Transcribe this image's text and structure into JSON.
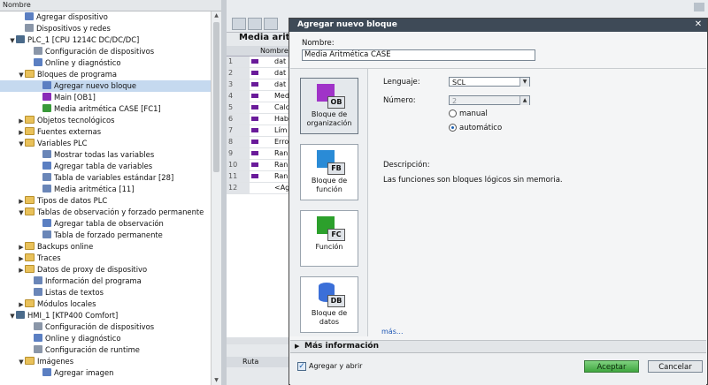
{
  "tree": {
    "header": "Nombre",
    "items": [
      {
        "label": "Agregar dispositivo",
        "indent": 2,
        "arrow": "",
        "icon": "add-device-icon",
        "cls": "i-blue"
      },
      {
        "label": "Dispositivos y redes",
        "indent": 2,
        "arrow": "",
        "icon": "network-icon",
        "cls": "i-gear"
      },
      {
        "label": "PLC_1 [CPU 1214C DC/DC/DC]",
        "indent": 1,
        "arrow": "▼",
        "icon": "plc-icon",
        "cls": "i-plc"
      },
      {
        "label": "Configuración de dispositivos",
        "indent": 3,
        "arrow": "",
        "icon": "device-config-icon",
        "cls": "i-gear"
      },
      {
        "label": "Online y diagnóstico",
        "indent": 3,
        "arrow": "",
        "icon": "diagnostic-icon",
        "cls": "i-blue"
      },
      {
        "label": "Bloques de programa",
        "indent": 2,
        "arrow": "▼",
        "icon": "folder-icon",
        "cls": "i-folder"
      },
      {
        "label": "Agregar nuevo bloque",
        "indent": 4,
        "arrow": "",
        "icon": "add-block-icon",
        "cls": "i-blue",
        "sel": true
      },
      {
        "label": "Main [OB1]",
        "indent": 4,
        "arrow": "",
        "icon": "ob-block-icon",
        "cls": "i-purple"
      },
      {
        "label": "Media aritmética CASE [FC1]",
        "indent": 4,
        "arrow": "",
        "icon": "fc-block-icon",
        "cls": "i-green"
      },
      {
        "label": "Objetos tecnológicos",
        "indent": 2,
        "arrow": "▶",
        "icon": "folder-icon",
        "cls": "i-folder"
      },
      {
        "label": "Fuentes externas",
        "indent": 2,
        "arrow": "▶",
        "icon": "folder-icon",
        "cls": "i-folder"
      },
      {
        "label": "Variables PLC",
        "indent": 2,
        "arrow": "▼",
        "icon": "folder-icon",
        "cls": "i-folder"
      },
      {
        "label": "Mostrar todas las variables",
        "indent": 4,
        "arrow": "",
        "icon": "variables-icon",
        "cls": "i-table"
      },
      {
        "label": "Agregar tabla de variables",
        "indent": 4,
        "arrow": "",
        "icon": "add-table-icon",
        "cls": "i-blue"
      },
      {
        "label": "Tabla de variables estándar [28]",
        "indent": 4,
        "arrow": "",
        "icon": "table-icon",
        "cls": "i-table"
      },
      {
        "label": "Media aritmética [11]",
        "indent": 4,
        "arrow": "",
        "icon": "table-icon",
        "cls": "i-table"
      },
      {
        "label": "Tipos de datos PLC",
        "indent": 2,
        "arrow": "▶",
        "icon": "folder-icon",
        "cls": "i-folder"
      },
      {
        "label": "Tablas de observación y forzado permanente",
        "indent": 2,
        "arrow": "▼",
        "icon": "folder-icon",
        "cls": "i-folder"
      },
      {
        "label": "Agregar tabla de observación",
        "indent": 4,
        "arrow": "",
        "icon": "add-watch-table-icon",
        "cls": "i-blue"
      },
      {
        "label": "Tabla de forzado permanente",
        "indent": 4,
        "arrow": "",
        "icon": "force-table-icon",
        "cls": "i-table"
      },
      {
        "label": "Backups online",
        "indent": 2,
        "arrow": "▶",
        "icon": "folder-icon",
        "cls": "i-folder"
      },
      {
        "label": "Traces",
        "indent": 2,
        "arrow": "▶",
        "icon": "folder-icon",
        "cls": "i-folder"
      },
      {
        "label": "Datos de proxy de dispositivo",
        "indent": 2,
        "arrow": "▶",
        "icon": "folder-icon",
        "cls": "i-folder"
      },
      {
        "label": "Información del programa",
        "indent": 3,
        "arrow": "",
        "icon": "program-info-icon",
        "cls": "i-table"
      },
      {
        "label": "Listas de textos",
        "indent": 3,
        "arrow": "",
        "icon": "text-list-icon",
        "cls": "i-table"
      },
      {
        "label": "Módulos locales",
        "indent": 2,
        "arrow": "▶",
        "icon": "folder-icon",
        "cls": "i-folder"
      },
      {
        "label": "HMI_1 [KTP400 Comfort]",
        "indent": 1,
        "arrow": "▼",
        "icon": "hmi-icon",
        "cls": "i-plc"
      },
      {
        "label": "Configuración de dispositivos",
        "indent": 3,
        "arrow": "",
        "icon": "device-config-icon",
        "cls": "i-gear"
      },
      {
        "label": "Online y diagnóstico",
        "indent": 3,
        "arrow": "",
        "icon": "diagnostic-icon",
        "cls": "i-blue"
      },
      {
        "label": "Configuración de runtime",
        "indent": 3,
        "arrow": "",
        "icon": "runtime-config-icon",
        "cls": "i-gear"
      },
      {
        "label": "Imágenes",
        "indent": 2,
        "arrow": "▼",
        "icon": "folder-icon",
        "cls": "i-folder"
      },
      {
        "label": "Agregar imagen",
        "indent": 4,
        "arrow": "",
        "icon": "add-image-icon",
        "cls": "i-blue"
      }
    ]
  },
  "editor": {
    "block_title": "Media aritm",
    "grid_header": "Nombre",
    "rows": [
      {
        "n": "1",
        "name": "dat"
      },
      {
        "n": "2",
        "name": "dat"
      },
      {
        "n": "3",
        "name": "dat"
      },
      {
        "n": "4",
        "name": "Med"
      },
      {
        "n": "5",
        "name": "Calc"
      },
      {
        "n": "6",
        "name": "Hab"
      },
      {
        "n": "7",
        "name": "Lím"
      },
      {
        "n": "8",
        "name": "Erro"
      },
      {
        "n": "9",
        "name": "Ran"
      },
      {
        "n": "10",
        "name": "Ran"
      },
      {
        "n": "11",
        "name": "Ran"
      },
      {
        "n": "12",
        "name": "<Ag"
      }
    ],
    "path_label": "Ruta"
  },
  "dialog": {
    "title": "Agregar nuevo bloque",
    "name_label": "Nombre:",
    "name_value": "Media Aritmética CASE",
    "block_types": [
      {
        "badge": "OB",
        "label": "Bloque de organización"
      },
      {
        "badge": "FB",
        "label": "Bloque de función"
      },
      {
        "badge": "FC",
        "label": "Función"
      },
      {
        "badge": "DB",
        "label": "Bloque de datos"
      }
    ],
    "language_label": "Lenguaje:",
    "language_value": "SCL",
    "number_label": "Número:",
    "number_value": "2",
    "radio_manual": "manual",
    "radio_auto": "automático",
    "description_label": "Descripción:",
    "description_text": "Las funciones son bloques lógicos sin memoria.",
    "more_link": "más...",
    "more_info": "Más información",
    "add_open_label": "Agregar y abrir",
    "ok_label": "Aceptar",
    "cancel_label": "Cancelar"
  }
}
